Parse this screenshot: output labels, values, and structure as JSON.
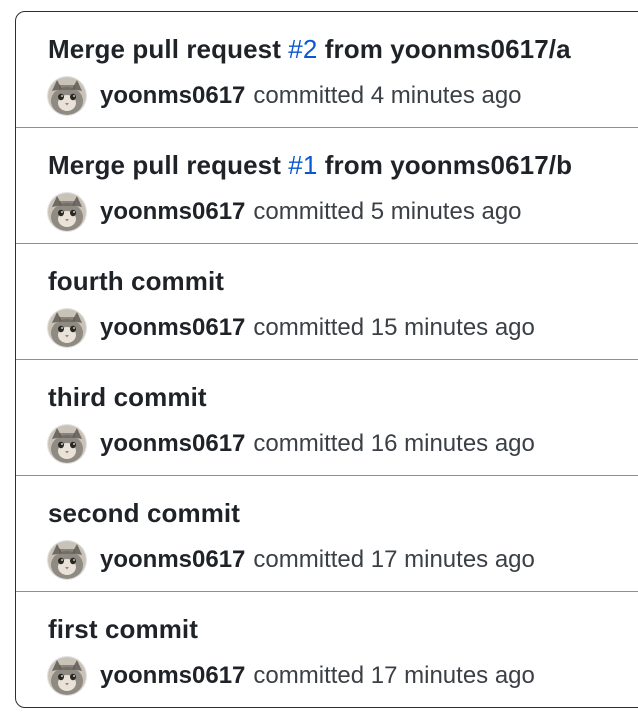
{
  "commits": [
    {
      "title_prefix": "Merge pull request ",
      "pr_number": "#2",
      "title_suffix": " from yoonms0617/a",
      "author": "yoonms0617",
      "committed_text": "committed 4 minutes ago"
    },
    {
      "title_prefix": "Merge pull request ",
      "pr_number": "#1",
      "title_suffix": " from yoonms0617/b",
      "author": "yoonms0617",
      "committed_text": "committed 5 minutes ago"
    },
    {
      "title": "fourth commit",
      "author": "yoonms0617",
      "committed_text": "committed 15 minutes ago"
    },
    {
      "title": "third commit",
      "author": "yoonms0617",
      "committed_text": "committed 16 minutes ago"
    },
    {
      "title": "second commit",
      "author": "yoonms0617",
      "committed_text": "committed 17 minutes ago"
    },
    {
      "title": "first commit",
      "author": "yoonms0617",
      "committed_text": "committed 17 minutes ago"
    }
  ],
  "colors": {
    "pr_link": "#0b57d0",
    "text_primary": "#1f2328",
    "text_secondary": "#3b4046",
    "border": "#2b2f33",
    "divider": "#8a9097"
  }
}
